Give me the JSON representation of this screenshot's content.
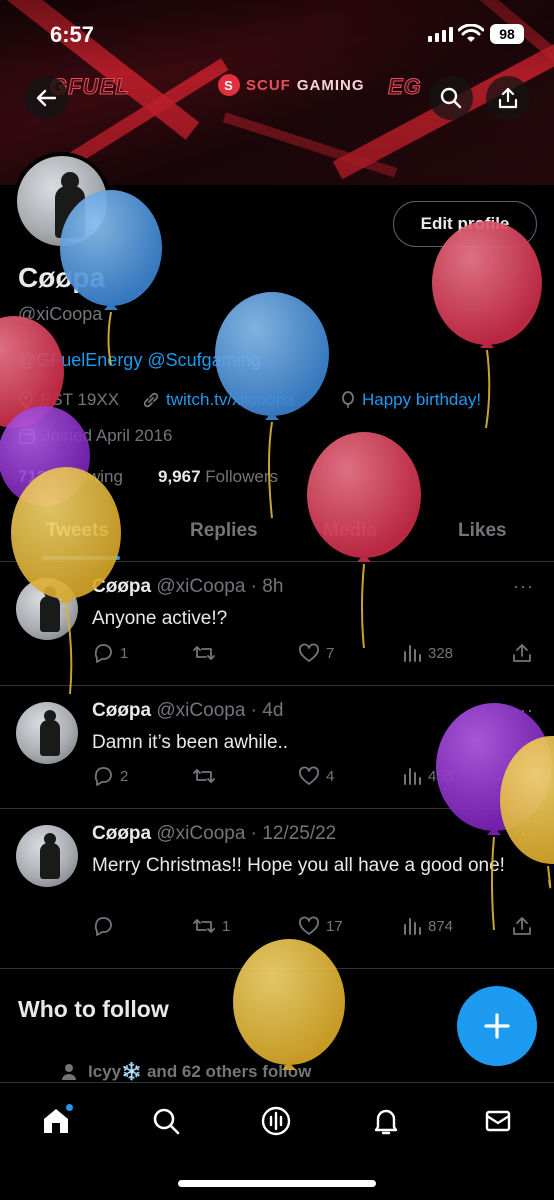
{
  "status_bar": {
    "time": "6:57",
    "battery": "98"
  },
  "banner": {
    "sponsors": [
      "GFUEL",
      "SCUF",
      "GAMING",
      "EG"
    ],
    "sponsor_logo_letter": "S"
  },
  "profile": {
    "name": "Cøøpa",
    "handle": "@xiCoopa",
    "bio": "@GFuelEnergy @Scufgaming",
    "location": "EST 19XX",
    "link": "twitch.tv/xiicoopa",
    "birthday": "Happy birthday!",
    "joined": "Joined April 2016",
    "following_count": "712",
    "following_label": "Following",
    "followers_count": "9,967",
    "followers_label": "Followers",
    "edit_label": "Edit profile"
  },
  "tabs": [
    {
      "label": "Tweets",
      "active": true
    },
    {
      "label": "Replies",
      "active": false
    },
    {
      "label": "Media",
      "active": false
    },
    {
      "label": "Likes",
      "active": false
    }
  ],
  "tweets": [
    {
      "name": "Cøøpa",
      "handle": "@xiCoopa",
      "time": "8h",
      "text": "Anyone active!?",
      "replies": "1",
      "retweets": "",
      "likes": "7",
      "views": "328"
    },
    {
      "name": "Cøøpa",
      "handle": "@xiCoopa",
      "time": "4d",
      "text": "Damn it’s been awhile..",
      "replies": "2",
      "retweets": "",
      "likes": "4",
      "views": "453"
    },
    {
      "name": "Cøøpa",
      "handle": "@xiCoopa",
      "time": "12/25/22",
      "text": "Merry Christmas!! Hope you all have a good one!",
      "replies": "",
      "retweets": "1",
      "likes": "17",
      "views": "874"
    }
  ],
  "who_to_follow": {
    "title": "Who to follow",
    "social_context": "Icyy❄️ and 62 others follow"
  },
  "more_glyph": "···",
  "colors": {
    "accent": "#1d9bf0",
    "text": "#e7e9ea",
    "muted": "#71767b",
    "border": "#2f3336",
    "balloon_blue": "#4f95d9",
    "balloon_red": "#d83a55",
    "balloon_yellow": "#e2b73b",
    "balloon_purple": "#8a2fc9"
  },
  "nav": [
    "home-icon",
    "search-icon",
    "spaces-icon",
    "notifications-icon",
    "messages-icon"
  ]
}
